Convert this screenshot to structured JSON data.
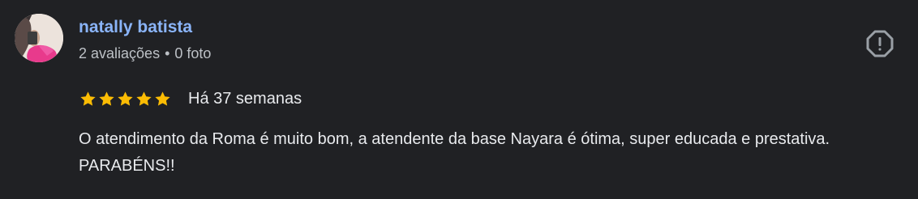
{
  "review": {
    "author": {
      "name": "natally batista",
      "reviews_count": "2 avaliações",
      "separator": "•",
      "photos_count": "0 foto",
      "avatar": "profile-photo"
    },
    "rating": {
      "stars": 5,
      "max": 5,
      "star_color": "#fbbc04"
    },
    "date": "Há 37 semanas",
    "text": "O atendimento da Roma é muito bom, a atendente da base Nayara é ótima, super educada e prestativa. PARABÉNS!!",
    "report_icon": "report-icon"
  },
  "colors": {
    "background": "#202124",
    "name": "#8ab4f8",
    "meta": "#bdc1c6",
    "text": "#e8eaed",
    "icon": "#9aa0a6"
  }
}
